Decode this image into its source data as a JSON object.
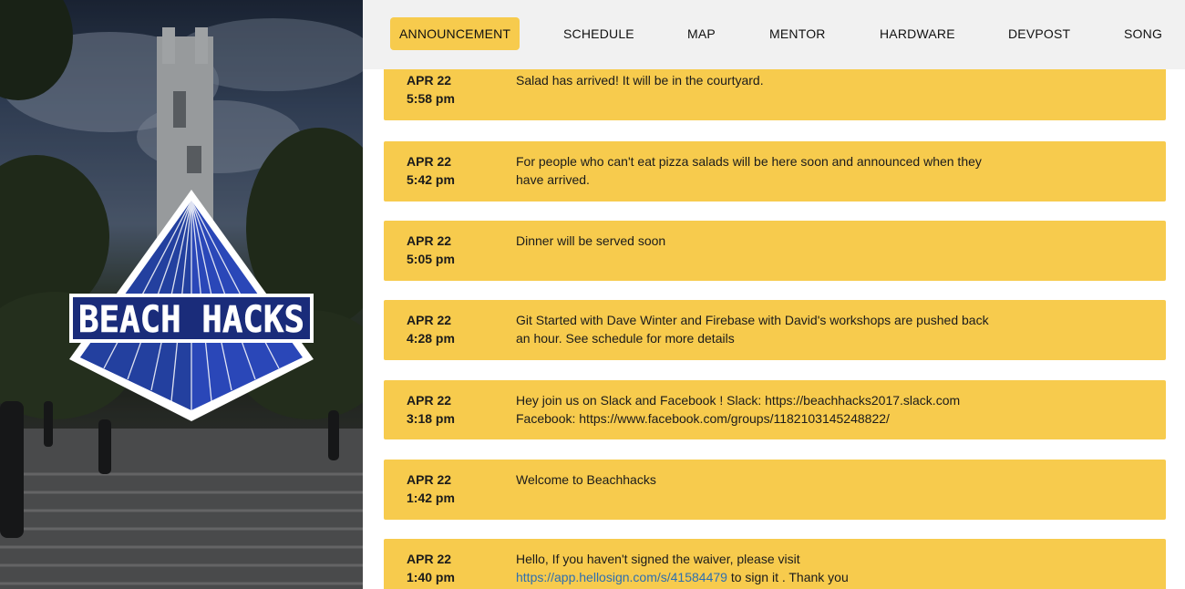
{
  "brand": {
    "logo_text": "BEACH HACKS",
    "colors": {
      "accent": "#f7cb4d",
      "logo_blue": "#2a47b8",
      "logo_navy": "#18286a"
    }
  },
  "nav": {
    "items": [
      {
        "label": "ANNOUNCEMENT",
        "active": true
      },
      {
        "label": "SCHEDULE",
        "active": false
      },
      {
        "label": "MAP",
        "active": false
      },
      {
        "label": "MENTOR",
        "active": false
      },
      {
        "label": "HARDWARE",
        "active": false
      },
      {
        "label": "DEVPOST",
        "active": false
      },
      {
        "label": "SONG",
        "active": false
      }
    ]
  },
  "announcements": [
    {
      "date": "APR 22",
      "time": "5:58 pm",
      "text": "Salad has arrived! It will be in the courtyard."
    },
    {
      "date": "APR 22",
      "time": "5:42 pm",
      "text": "For people who can't eat pizza salads will be here soon and announced when they have arrived."
    },
    {
      "date": "APR 22",
      "time": "5:05 pm",
      "text": "Dinner will be served soon"
    },
    {
      "date": "APR 22",
      "time": "4:28 pm",
      "text": "Git Started with Dave Winter and Firebase with David's workshops are pushed back an hour. See schedule for more details"
    },
    {
      "date": "APR 22",
      "time": "3:18 pm",
      "text": "Hey join us on Slack and Facebook ! Slack: https://beachhacks2017.slack.com",
      "text2": "Facebook: https://www.facebook.com/groups/1182103145248822/"
    },
    {
      "date": "APR 22",
      "time": "1:42 pm",
      "text": "Welcome to Beachhacks"
    },
    {
      "date": "APR 22",
      "time": "1:40 pm",
      "text": "Hello, If you haven't signed the waiver, please visit",
      "link": "https://app.hellosign.com/s/41584479",
      "text_after": " to sign it . Thank you"
    }
  ]
}
